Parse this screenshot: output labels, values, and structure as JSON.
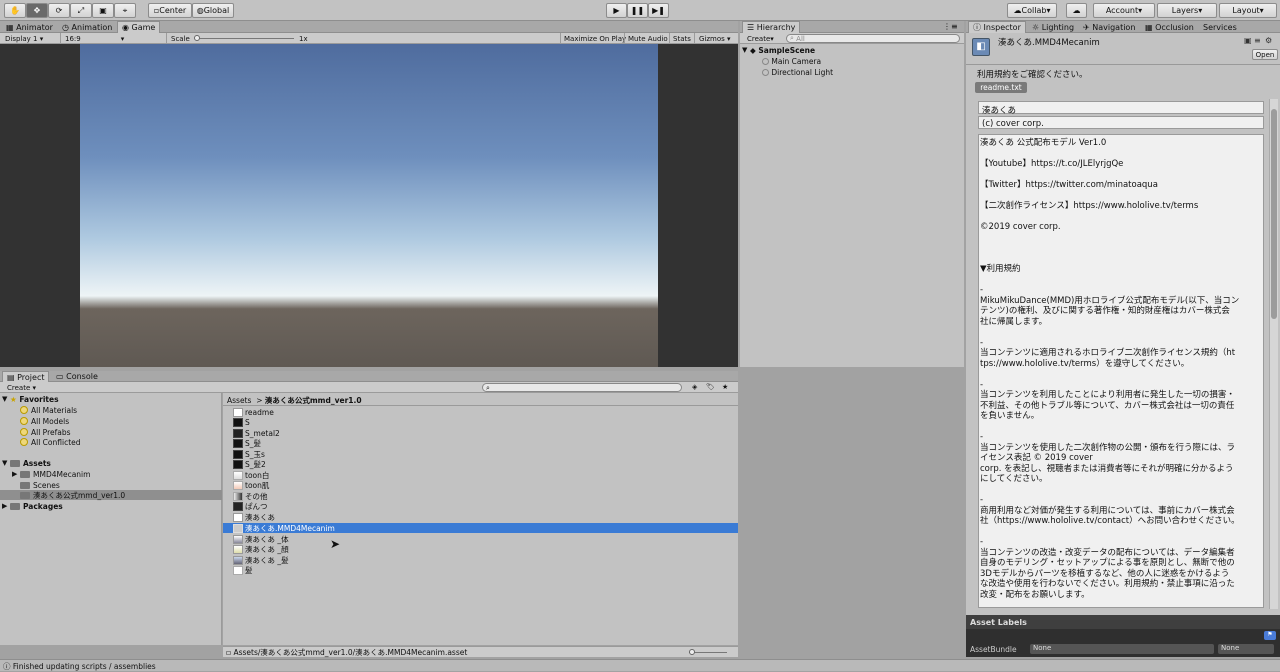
{
  "toolbar": {
    "tools": [
      "hand-tool-icon",
      "move-tool-icon",
      "rotate-tool-icon",
      "scale-tool-icon",
      "rect-tool-icon",
      "transform-tool-icon"
    ],
    "pivot": "Center",
    "space": "Global",
    "collab": "Collab",
    "account": "Account",
    "layers": "Layers",
    "layout": "Layout"
  },
  "scene_tabs": {
    "animator": "Animator",
    "animation": "Animation",
    "game": "Game",
    "display": "Display 1",
    "aspect": "16:9",
    "scale_label": "Scale",
    "scale_value": "1x",
    "maximize": "Maximize On Play",
    "mute": "Mute Audio",
    "stats": "Stats",
    "gizmos": "Gizmos"
  },
  "hierarchy": {
    "tab": "Hierarchy",
    "create": "Create",
    "search_placeholder": "All",
    "scene": "SampleScene",
    "items": [
      "Main Camera",
      "Directional Light"
    ]
  },
  "project": {
    "tab_project": "Project",
    "tab_console": "Console",
    "create": "Create",
    "favorites": {
      "label": "Favorites",
      "items": [
        "All Materials",
        "All Models",
        "All Prefabs",
        "All Conflicted"
      ]
    },
    "assets": {
      "label": "Assets",
      "items": [
        "MMD4Mecanim",
        "Scenes",
        "湊あくあ公式mmd_ver1.0"
      ]
    },
    "packages": "Packages",
    "breadcrumb_root": "Assets",
    "breadcrumb_folder": "湊あくあ公式mmd_ver1.0",
    "files": [
      "readme",
      "S",
      "S_metal2",
      "S_髪",
      "S_玉s",
      "S_髪2",
      "toon白",
      "toon肌",
      "その他",
      "ぱんつ",
      "湊あくあ",
      "湊あくあ.MMD4Mecanim",
      "湊あくあ _体",
      "湊あくあ _顔",
      "湊あくあ _髪",
      "髪"
    ],
    "selected_file": "湊あくあ.MMD4Mecanim",
    "path": "Assets/湊あくあ公式mmd_ver1.0/湊あくあ.MMD4Mecanim.asset"
  },
  "inspector": {
    "tabs": [
      "Inspector",
      "Lighting",
      "Navigation",
      "Occlusion",
      "Services"
    ],
    "title": "湊あくあ.MMD4Mecanim",
    "open": "Open",
    "notice": "利用規約をご確認ください。",
    "readme_button": "readme.txt",
    "name_field": "湊あくあ",
    "copyright_field": "(c) cover corp.",
    "body": [
      "湊あくあ 公式配布モデル Ver1.0",
      "",
      "【Youtube】https://t.co/JLElyrjgQe",
      "",
      "【Twitter】https://twitter.com/minatoaqua",
      "",
      "【二次創作ライセンス】https://www.hololive.tv/terms",
      "",
      "©2019 cover corp.",
      "",
      "",
      "",
      "▼利用規約",
      "",
      "-",
      "MikuMikuDance(MMD)用ホロライブ公式配布モデル(以下、当コン",
      "テンツ)の権利、及びに関する著作権・知的財産権はカバー株式会",
      "社に帰属します。",
      "",
      "-",
      "当コンテンツに適用されるホロライブ二次創作ライセンス規約（ht",
      "tps://www.hololive.tv/terms）を遵守してください。",
      "",
      "-",
      "当コンテンツを利用したことにより利用者に発生した一切の損害・",
      "不利益、その他トラブル等について、カバー株式会社は一切の責任",
      "を負いません。",
      "",
      "-",
      "当コンテンツを使用した二次創作物の公開・頒布を行う際には、ラ",
      "イセンス表記 © 2019 cover",
      "corp. を表記し、視聴者または消費者等にそれが明確に分かるよう",
      "にしてください。",
      "",
      "-",
      "商用利用など対価が発生する利用については、事前にカバー株式会",
      "社（https://www.hololive.tv/contact）へお問い合わせください。",
      "",
      "-",
      "当コンテンツの改造・改変データの配布については、データ編集者",
      "自身のモデリング・セットアップによる事を原則とし、無断で他の",
      "3Dモデルからパーツを移植するなど、他の人に迷惑をかけるよう",
      "な改造や使用を行わないでください。利用規約・禁止事項に沿った",
      "改変・配布をお願いします。"
    ],
    "asset_labels": "Asset Labels",
    "asset_bundle": "AssetBundle",
    "bundle_value": "None",
    "variant_value": "None"
  },
  "status": "Finished updating scripts / assemblies"
}
